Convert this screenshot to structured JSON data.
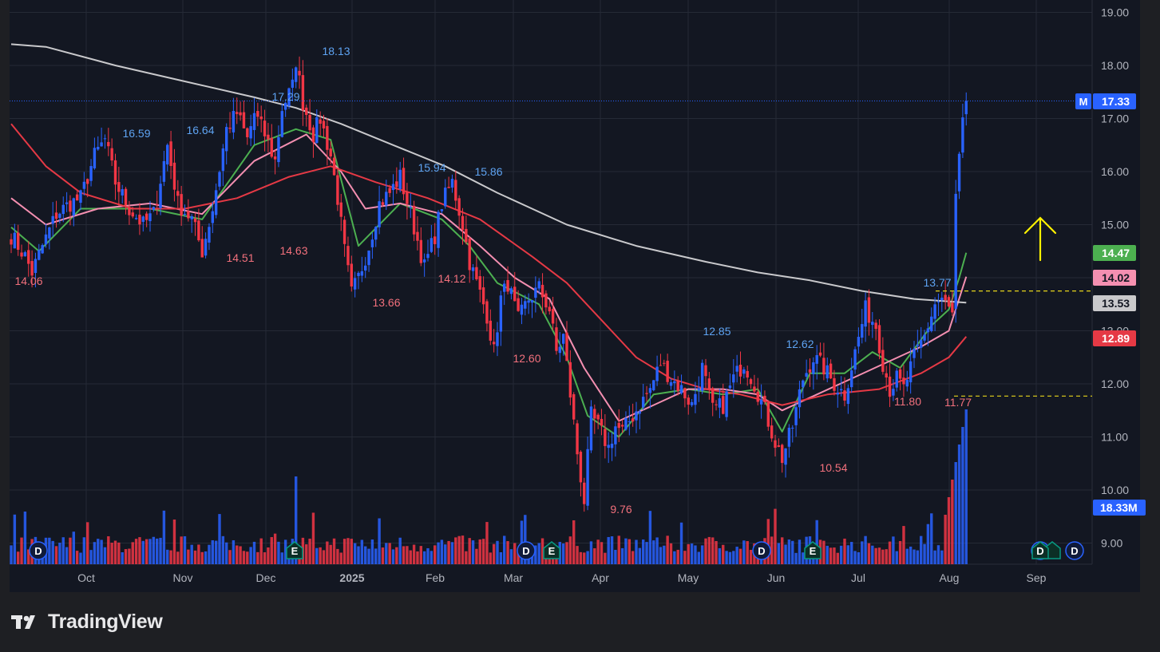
{
  "brand": {
    "name": "TradingView"
  },
  "colors": {
    "background": "#131722",
    "frame": "#1e1f23",
    "grid": "#252a36",
    "up": "#2962ff",
    "down": "#f23645",
    "ma_fast": "#4caf50",
    "ma_mid": "#f48fb1",
    "ma_slow": "#e53945",
    "ma_long": "#c9c9cc",
    "axis_text": "#b2b5be",
    "arrow": "#fff200",
    "level_line": "#e6d51a",
    "high_label": "#5ea3f2",
    "low_label": "#f2707c"
  },
  "chart_data": {
    "type": "candlestick",
    "title": "",
    "xlabel": "",
    "ylabel": "",
    "ylim": [
      8.8,
      19.2
    ],
    "grid": true,
    "x_ticks": [
      "Oct",
      "Nov",
      "Dec",
      "2025",
      "Feb",
      "Mar",
      "Apr",
      "May",
      "Jun",
      "Jul",
      "Aug",
      "Sep"
    ],
    "y_ticks": [
      "9.00",
      "10.00",
      "11.00",
      "12.00",
      "13.00",
      "14.00",
      "15.00",
      "16.00",
      "17.00",
      "18.00",
      "19.00"
    ],
    "high_labels": [
      "16.59",
      "16.64",
      "17.29",
      "18.13",
      "15.94",
      "15.86",
      "12.85",
      "12.62",
      "13.77"
    ],
    "low_labels": [
      "14.06",
      "14.51",
      "14.63",
      "13.66",
      "14.12",
      "12.60",
      "9.76",
      "10.54",
      "11.80",
      "11.77"
    ],
    "price_tags": [
      {
        "label": "17.33",
        "prefix": "M",
        "value": 17.33,
        "color": "#2962ff"
      },
      {
        "label": "14.47",
        "value": 14.47,
        "color": "#4caf50"
      },
      {
        "label": "14.02",
        "value": 14.02,
        "color": "#f48fb1"
      },
      {
        "label": "13.53",
        "value": 13.53,
        "color": "#c9c9cc"
      },
      {
        "label": "12.89",
        "value": 12.89,
        "color": "#e53945"
      }
    ],
    "volume_tag": "18.33M",
    "horizontal_levels": [
      13.75,
      11.77
    ],
    "last_price_line": 17.33,
    "event_markers": [
      {
        "label": "D",
        "kind": "dividend"
      },
      {
        "label": "E",
        "kind": "earnings"
      },
      {
        "label": "D",
        "kind": "dividend"
      },
      {
        "label": "E",
        "kind": "earnings"
      },
      {
        "label": "D",
        "kind": "dividend"
      },
      {
        "label": "E",
        "kind": "earnings"
      },
      {
        "label": "D",
        "kind": "dividend"
      },
      {
        "label": "E",
        "kind": "earnings"
      },
      {
        "label": "D",
        "kind": "dividend"
      }
    ],
    "series": [
      {
        "name": "",
        "kind": "price",
        "points": [
          [
            0,
            14.8
          ],
          [
            4,
            14.4
          ],
          [
            6,
            14.1
          ],
          [
            9,
            14.6
          ],
          [
            13,
            15.2
          ],
          [
            17,
            15.4
          ],
          [
            20,
            15.5
          ],
          [
            24,
            16.3
          ],
          [
            27,
            16.6
          ],
          [
            30,
            15.8
          ],
          [
            34,
            15.3
          ],
          [
            38,
            15.0
          ],
          [
            41,
            15.2
          ],
          [
            45,
            16.5
          ],
          [
            48,
            15.4
          ],
          [
            52,
            15.1
          ],
          [
            55,
            14.5
          ],
          [
            58,
            15.3
          ],
          [
            62,
            16.8
          ],
          [
            65,
            17.1
          ],
          [
            68,
            16.6
          ],
          [
            70,
            17.1
          ],
          [
            73,
            16.7
          ],
          [
            76,
            16.2
          ],
          [
            78,
            17.2
          ],
          [
            81,
            17.6
          ],
          [
            82,
            18.1
          ],
          [
            84,
            17.3
          ],
          [
            87,
            16.7
          ],
          [
            89,
            17.0
          ],
          [
            92,
            16.3
          ],
          [
            94,
            15.5
          ],
          [
            96,
            14.5
          ],
          [
            98,
            13.7
          ],
          [
            100,
            14.0
          ],
          [
            103,
            14.6
          ],
          [
            106,
            15.4
          ],
          [
            109,
            15.6
          ],
          [
            112,
            15.9
          ],
          [
            115,
            15.2
          ],
          [
            117,
            14.7
          ],
          [
            119,
            14.2
          ],
          [
            122,
            14.8
          ],
          [
            124,
            15.4
          ],
          [
            127,
            15.8
          ],
          [
            130,
            15.0
          ],
          [
            132,
            14.3
          ],
          [
            135,
            13.7
          ],
          [
            137,
            13.3
          ],
          [
            139,
            12.6
          ],
          [
            141,
            13.6
          ],
          [
            143,
            13.9
          ],
          [
            146,
            13.2
          ],
          [
            149,
            13.6
          ],
          [
            152,
            13.8
          ],
          [
            155,
            13.4
          ],
          [
            157,
            12.6
          ],
          [
            159,
            12.9
          ],
          [
            161,
            11.8
          ],
          [
            163,
            10.7
          ],
          [
            165,
            9.8
          ],
          [
            167,
            11.4
          ],
          [
            169,
            11.2
          ],
          [
            172,
            10.8
          ],
          [
            174,
            11.2
          ],
          [
            176,
            11.1
          ],
          [
            178,
            11.3
          ],
          [
            181,
            11.6
          ],
          [
            184,
            11.9
          ],
          [
            187,
            12.4
          ],
          [
            190,
            12.1
          ],
          [
            193,
            11.9
          ],
          [
            196,
            11.6
          ],
          [
            199,
            12.3
          ],
          [
            202,
            11.5
          ],
          [
            205,
            11.6
          ],
          [
            208,
            12.1
          ],
          [
            211,
            12.4
          ],
          [
            214,
            12.0
          ],
          [
            217,
            11.5
          ],
          [
            220,
            10.9
          ],
          [
            222,
            10.6
          ],
          [
            225,
            11.2
          ],
          [
            228,
            12.1
          ],
          [
            231,
            12.5
          ],
          [
            234,
            12.3
          ],
          [
            237,
            12.0
          ],
          [
            240,
            11.8
          ],
          [
            243,
            12.6
          ],
          [
            246,
            13.4
          ],
          [
            249,
            13.1
          ],
          [
            251,
            12.4
          ],
          [
            253,
            11.9
          ],
          [
            255,
            12.1
          ],
          [
            257,
            11.9
          ],
          [
            260,
            12.5
          ],
          [
            263,
            12.9
          ],
          [
            266,
            13.5
          ],
          [
            268,
            13.6
          ],
          [
            270,
            13.4
          ],
          [
            271,
            13.3
          ],
          [
            272,
            15.5
          ],
          [
            273,
            16.2
          ],
          [
            274,
            16.9
          ],
          [
            275,
            17.33
          ]
        ]
      },
      {
        "name": "",
        "kind": "ma_fast",
        "points": [
          [
            0,
            14.95
          ],
          [
            8,
            14.5
          ],
          [
            20,
            15.3
          ],
          [
            40,
            15.3
          ],
          [
            55,
            15.1
          ],
          [
            70,
            16.5
          ],
          [
            82,
            16.8
          ],
          [
            92,
            16.6
          ],
          [
            100,
            14.6
          ],
          [
            112,
            15.4
          ],
          [
            124,
            15.1
          ],
          [
            132,
            14.6
          ],
          [
            140,
            13.9
          ],
          [
            152,
            13.5
          ],
          [
            160,
            12.5
          ],
          [
            166,
            11.4
          ],
          [
            175,
            11.0
          ],
          [
            185,
            11.8
          ],
          [
            195,
            11.9
          ],
          [
            205,
            11.8
          ],
          [
            215,
            11.9
          ],
          [
            222,
            11.1
          ],
          [
            230,
            12.2
          ],
          [
            240,
            12.2
          ],
          [
            248,
            12.6
          ],
          [
            256,
            12.3
          ],
          [
            265,
            13.1
          ],
          [
            270,
            13.4
          ],
          [
            273,
            14.0
          ],
          [
            275,
            14.47
          ]
        ]
      },
      {
        "name": "",
        "kind": "ma_mid",
        "points": [
          [
            0,
            15.5
          ],
          [
            10,
            15.0
          ],
          [
            25,
            15.3
          ],
          [
            40,
            15.4
          ],
          [
            55,
            15.2
          ],
          [
            70,
            16.2
          ],
          [
            85,
            16.7
          ],
          [
            95,
            16.0
          ],
          [
            102,
            15.3
          ],
          [
            112,
            15.4
          ],
          [
            124,
            15.2
          ],
          [
            135,
            14.6
          ],
          [
            145,
            14.0
          ],
          [
            155,
            13.6
          ],
          [
            165,
            12.3
          ],
          [
            175,
            11.3
          ],
          [
            185,
            11.6
          ],
          [
            195,
            11.9
          ],
          [
            205,
            11.9
          ],
          [
            215,
            11.8
          ],
          [
            222,
            11.5
          ],
          [
            232,
            11.8
          ],
          [
            242,
            12.1
          ],
          [
            252,
            12.4
          ],
          [
            262,
            12.7
          ],
          [
            270,
            13.0
          ],
          [
            275,
            14.02
          ]
        ]
      },
      {
        "name": "",
        "kind": "ma_slow",
        "points": [
          [
            0,
            16.9
          ],
          [
            10,
            16.1
          ],
          [
            20,
            15.6
          ],
          [
            35,
            15.3
          ],
          [
            50,
            15.3
          ],
          [
            65,
            15.5
          ],
          [
            80,
            15.9
          ],
          [
            92,
            16.1
          ],
          [
            105,
            15.8
          ],
          [
            120,
            15.5
          ],
          [
            135,
            15.1
          ],
          [
            150,
            14.4
          ],
          [
            160,
            13.9
          ],
          [
            170,
            13.2
          ],
          [
            180,
            12.5
          ],
          [
            190,
            12.1
          ],
          [
            200,
            11.9
          ],
          [
            210,
            11.8
          ],
          [
            222,
            11.6
          ],
          [
            235,
            11.8
          ],
          [
            250,
            11.9
          ],
          [
            262,
            12.2
          ],
          [
            270,
            12.5
          ],
          [
            275,
            12.89
          ]
        ]
      },
      {
        "name": "",
        "kind": "ma_long",
        "points": [
          [
            0,
            18.4
          ],
          [
            10,
            18.35
          ],
          [
            30,
            18.0
          ],
          [
            50,
            17.7
          ],
          [
            70,
            17.4
          ],
          [
            82,
            17.2
          ],
          [
            95,
            16.9
          ],
          [
            110,
            16.5
          ],
          [
            125,
            16.1
          ],
          [
            140,
            15.6
          ],
          [
            160,
            15.0
          ],
          [
            180,
            14.6
          ],
          [
            200,
            14.3
          ],
          [
            215,
            14.1
          ],
          [
            230,
            13.95
          ],
          [
            245,
            13.75
          ],
          [
            260,
            13.6
          ],
          [
            275,
            13.53
          ]
        ]
      }
    ]
  }
}
